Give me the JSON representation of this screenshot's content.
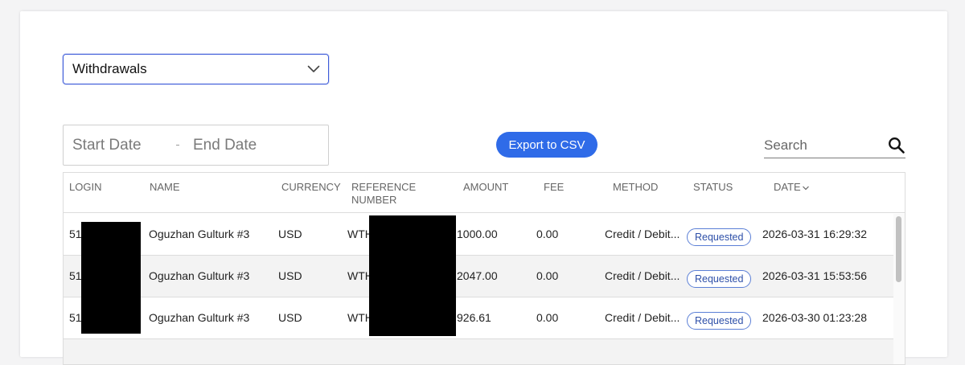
{
  "filters": {
    "type_select": {
      "value": "Withdrawals"
    },
    "start_date_placeholder": "Start Date",
    "end_date_placeholder": "End Date",
    "export_label": "Export to CSV",
    "search_placeholder": "Search"
  },
  "table": {
    "columns": {
      "login": "LOGIN",
      "name": "NAME",
      "currency": "CURRENCY",
      "reference_line1": "REFERENCE",
      "reference_line2": "NUMBER",
      "amount": "AMOUNT",
      "fee": "FEE",
      "method": "METHOD",
      "status": "STATUS",
      "date": "DATE"
    },
    "rows": [
      {
        "login": "51",
        "name": "Oguzhan Gulturk #3",
        "currency": "USD",
        "reference": "WTH",
        "amount": "1000.00",
        "fee": "0.00",
        "method": "Credit / Debit...",
        "status": "Requested",
        "date": "2026-03-31 16:29:32"
      },
      {
        "login": "51",
        "name": "Oguzhan Gulturk #3",
        "currency": "USD",
        "reference": "WTH",
        "amount": "2047.00",
        "fee": "0.00",
        "method": "Credit / Debit...",
        "status": "Requested",
        "date": "2026-03-31 15:53:56"
      },
      {
        "login": "51",
        "name": "Oguzhan Gulturk #3",
        "currency": "USD",
        "reference": "WTH",
        "amount": "926.61",
        "fee": "0.00",
        "method": "Credit / Debit...",
        "status": "Requested",
        "date": "2026-03-30 01:23:28"
      }
    ]
  },
  "colors": {
    "accent": "#2f6be8",
    "select_border": "#3d5bd9",
    "badge_border": "#5b7fd6",
    "redaction": "#000000"
  },
  "icons": {
    "select_chevron": "chevron-down-icon",
    "search": "search-icon",
    "sort": "sort-desc-icon"
  }
}
